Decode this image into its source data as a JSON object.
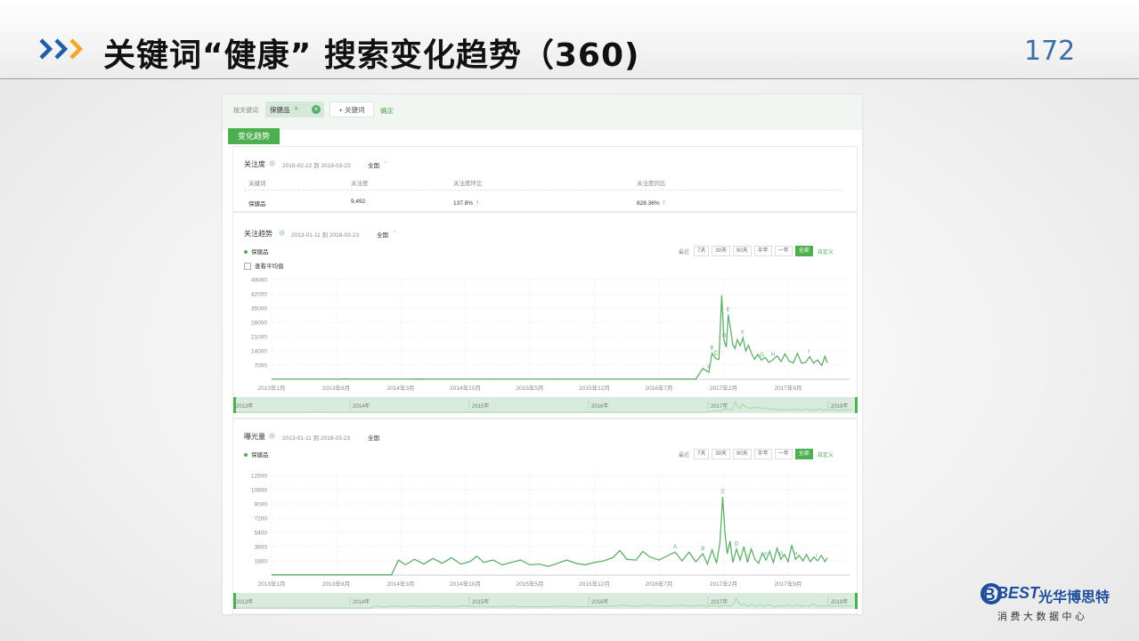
{
  "slide": {
    "title": "关键词“健康” 搜索变化趋势（360)",
    "page_number": "172",
    "accent_blue": "#1f5fa8",
    "accent_orange": "#f5a623"
  },
  "keyword_bar": {
    "label": "按关键词",
    "chip": "保健品",
    "chip_plus": "+",
    "chip_close": "×",
    "add_keyword": "+ 关键词",
    "confirm": "确定"
  },
  "trend_tab": "变化趋势",
  "attention": {
    "title": "关注度",
    "date_range": "2018-02-22 到 2018-03-23",
    "scope": "全国",
    "scope_arrow": "›",
    "headers": [
      "关键词",
      "关注度",
      "关注度环比",
      "关注度同比"
    ],
    "row": {
      "keyword": "保健品",
      "value": "9,492",
      "mom": "137.8%",
      "yoy": "828.36%",
      "arrow": "↑"
    }
  },
  "range_buttons": {
    "label": "最近",
    "options": [
      "7天",
      "30天",
      "90天",
      "半年",
      "一年",
      "全部"
    ],
    "active": "全部",
    "custom": "自定义"
  },
  "chart_a": {
    "title": "关注趋势",
    "date_range": "2013-01-11 到 2018-03-23",
    "scope": "全国",
    "scope_arrow": "›",
    "legend": "保健品",
    "avg_toggle": "查看平均值"
  },
  "chart_b": {
    "title": "曝光量",
    "date_range": "2013-01-11 到 2018-03-23",
    "scope": "全国",
    "legend": "保健品"
  },
  "navigator_years": [
    "2013年",
    "2014年",
    "2015年",
    "2016年",
    "2017年",
    "2018年"
  ],
  "brand": {
    "logo": "BEST",
    "name": "光华博思特",
    "tagline": "消 费 大 数 据 中 心",
    "color": "#1f4e9c"
  },
  "chart_data": [
    {
      "type": "line",
      "title": "关注趋势",
      "series": [
        {
          "name": "保健品",
          "color": "#5fae6b"
        }
      ],
      "x_ticks": [
        "2013年1月",
        "2013年8月",
        "2014年3月",
        "2014年10月",
        "2015年5月",
        "2015年12月",
        "2016年7月",
        "2017年2月",
        "2017年9月"
      ],
      "y_ticks": [
        7000,
        14000,
        21000,
        28000,
        35000,
        42000,
        49000
      ],
      "ylim": [
        0,
        49000
      ],
      "markers": [
        "A",
        "B",
        "C",
        "D",
        "E",
        "F",
        "G",
        "H",
        "I"
      ],
      "points": [
        [
          0,
          30
        ],
        [
          8,
          30
        ],
        [
          14,
          30
        ],
        [
          16,
          230
        ],
        [
          18,
          30
        ],
        [
          30,
          30
        ],
        [
          32,
          140
        ],
        [
          34,
          30
        ],
        [
          46,
          30
        ],
        [
          48,
          90
        ],
        [
          50,
          30
        ],
        [
          60,
          30
        ],
        [
          62,
          70
        ],
        [
          64,
          30
        ],
        [
          76,
          30
        ],
        [
          82,
          40
        ],
        [
          88,
          80
        ],
        [
          92,
          70
        ],
        [
          93.5,
          5300
        ],
        [
          94.8,
          3400
        ],
        [
          95.5,
          12800
        ],
        [
          96.3,
          10200
        ],
        [
          97,
          9700
        ],
        [
          97.6,
          41300
        ],
        [
          98.1,
          19000
        ],
        [
          98.6,
          15800
        ],
        [
          99.0,
          31700
        ],
        [
          99.5,
          24800
        ],
        [
          100,
          17000
        ],
        [
          100.5,
          15100
        ],
        [
          101,
          19500
        ],
        [
          101.6,
          16500
        ],
        [
          102.2,
          20300
        ],
        [
          102.8,
          13900
        ],
        [
          103.4,
          16700
        ],
        [
          104,
          13000
        ],
        [
          104.7,
          9800
        ],
        [
          105.4,
          12200
        ],
        [
          106.2,
          9400
        ],
        [
          107,
          10700
        ],
        [
          107.8,
          8300
        ],
        [
          108.7,
          9600
        ],
        [
          109.6,
          11500
        ],
        [
          110.5,
          8700
        ],
        [
          111.3,
          12500
        ],
        [
          112.2,
          9000
        ],
        [
          113.1,
          8000
        ],
        [
          114,
          12700
        ],
        [
          114.9,
          7900
        ],
        [
          115.8,
          8300
        ],
        [
          116.7,
          11100
        ],
        [
          117.5,
          7900
        ],
        [
          118.4,
          9500
        ],
        [
          119.3,
          6800
        ],
        [
          120,
          11300
        ],
        [
          120.5,
          8100
        ]
      ]
    },
    {
      "type": "line",
      "title": "曝光量",
      "series": [
        {
          "name": "保健品",
          "color": "#5fae6b"
        }
      ],
      "x_ticks": [
        "2013年1月",
        "2013年8月",
        "2014年3月",
        "2014年10月",
        "2015年5月",
        "2015年12月",
        "2016年7月",
        "2017年2月",
        "2017年9月"
      ],
      "y_ticks": [
        1800,
        3600,
        5400,
        7200,
        9000,
        10800,
        12600
      ],
      "ylim": [
        0,
        12600
      ],
      "markers": [
        "A",
        "B",
        "C",
        "D",
        "E",
        "F",
        "G",
        "H",
        "I"
      ],
      "points": [
        [
          0,
          30
        ],
        [
          26,
          30
        ],
        [
          27.5,
          1900
        ],
        [
          29,
          1300
        ],
        [
          31,
          2000
        ],
        [
          33,
          1400
        ],
        [
          35,
          2100
        ],
        [
          37,
          1500
        ],
        [
          39,
          2200
        ],
        [
          41,
          1400
        ],
        [
          43,
          1700
        ],
        [
          44.5,
          2400
        ],
        [
          46,
          1600
        ],
        [
          48,
          1900
        ],
        [
          50,
          1300
        ],
        [
          52,
          1600
        ],
        [
          54,
          1900
        ],
        [
          56,
          1300
        ],
        [
          58,
          1400
        ],
        [
          60,
          1100
        ],
        [
          62,
          1500
        ],
        [
          64,
          1900
        ],
        [
          66,
          1500
        ],
        [
          68,
          1300
        ],
        [
          70,
          1600
        ],
        [
          72,
          1800
        ],
        [
          74,
          2200
        ],
        [
          75.5,
          3100
        ],
        [
          77,
          2000
        ],
        [
          79,
          1900
        ],
        [
          80.5,
          3000
        ],
        [
          82,
          2300
        ],
        [
          84,
          1900
        ],
        [
          86,
          2500
        ],
        [
          87.5,
          2900
        ],
        [
          89,
          1800
        ],
        [
          90.5,
          2900
        ],
        [
          92,
          1700
        ],
        [
          93.5,
          2700
        ],
        [
          94.5,
          1400
        ],
        [
          95.5,
          3200
        ],
        [
          96.5,
          1500
        ],
        [
          97.2,
          4100
        ],
        [
          97.8,
          9900
        ],
        [
          98.3,
          5300
        ],
        [
          98.8,
          2700
        ],
        [
          99.4,
          4300
        ],
        [
          100,
          1600
        ],
        [
          100.8,
          3300
        ],
        [
          101.6,
          1900
        ],
        [
          102.4,
          3600
        ],
        [
          103.2,
          1600
        ],
        [
          104,
          3300
        ],
        [
          104.8,
          2000
        ],
        [
          105.6,
          1500
        ],
        [
          106.4,
          2800
        ],
        [
          107.2,
          1900
        ],
        [
          108,
          3000
        ],
        [
          108.8,
          1600
        ],
        [
          109.6,
          3400
        ],
        [
          110.4,
          2000
        ],
        [
          111.2,
          2600
        ],
        [
          112,
          1700
        ],
        [
          112.8,
          3800
        ],
        [
          113.6,
          2000
        ],
        [
          114.4,
          2500
        ],
        [
          115.2,
          1800
        ],
        [
          116,
          2600
        ],
        [
          116.8,
          1700
        ],
        [
          117.6,
          2300
        ],
        [
          118.4,
          1800
        ],
        [
          119.2,
          2500
        ],
        [
          120,
          1700
        ],
        [
          120.5,
          2200
        ]
      ]
    }
  ]
}
